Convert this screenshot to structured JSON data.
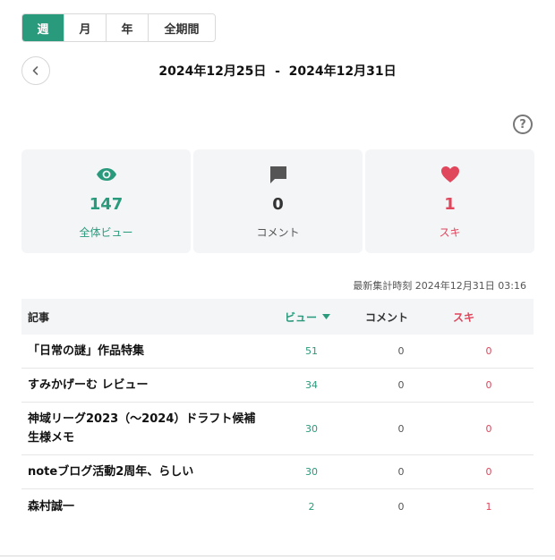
{
  "tabs": [
    {
      "label": "週",
      "active": true
    },
    {
      "label": "月",
      "active": false
    },
    {
      "label": "年",
      "active": false
    },
    {
      "label": "全期間",
      "active": false
    }
  ],
  "date_range": "2024年12月25日  -  2024年12月31日",
  "help_label": "?",
  "stats": {
    "views": {
      "value": "147",
      "label": "全体ビュー",
      "icon": "eye-icon"
    },
    "comments": {
      "value": "0",
      "label": "コメント",
      "icon": "comment-icon"
    },
    "likes": {
      "value": "1",
      "label": "スキ",
      "icon": "heart-icon"
    }
  },
  "updated_at": "最新集計時刻 2024年12月31日 03:16",
  "table": {
    "headers": {
      "title": "記事",
      "views": "ビュー",
      "comments": "コメント",
      "likes": "スキ"
    },
    "rows": [
      {
        "title": "「日常の謎」作品特集",
        "views": "51",
        "comments": "0",
        "likes": "0"
      },
      {
        "title": "すみかげーむ レビュー",
        "views": "34",
        "comments": "0",
        "likes": "0"
      },
      {
        "title": "神域リーグ2023（〜2024）ドラフト候補生様メモ",
        "views": "30",
        "comments": "0",
        "likes": "0"
      },
      {
        "title": "noteブログ活動2周年、らしい",
        "views": "30",
        "comments": "0",
        "likes": "0"
      },
      {
        "title": "森村誠一",
        "views": "2",
        "comments": "0",
        "likes": "1"
      }
    ]
  },
  "colors": {
    "accent": "#2a9a7c",
    "like": "#e0465c",
    "card_bg": "#f3f5f7"
  }
}
